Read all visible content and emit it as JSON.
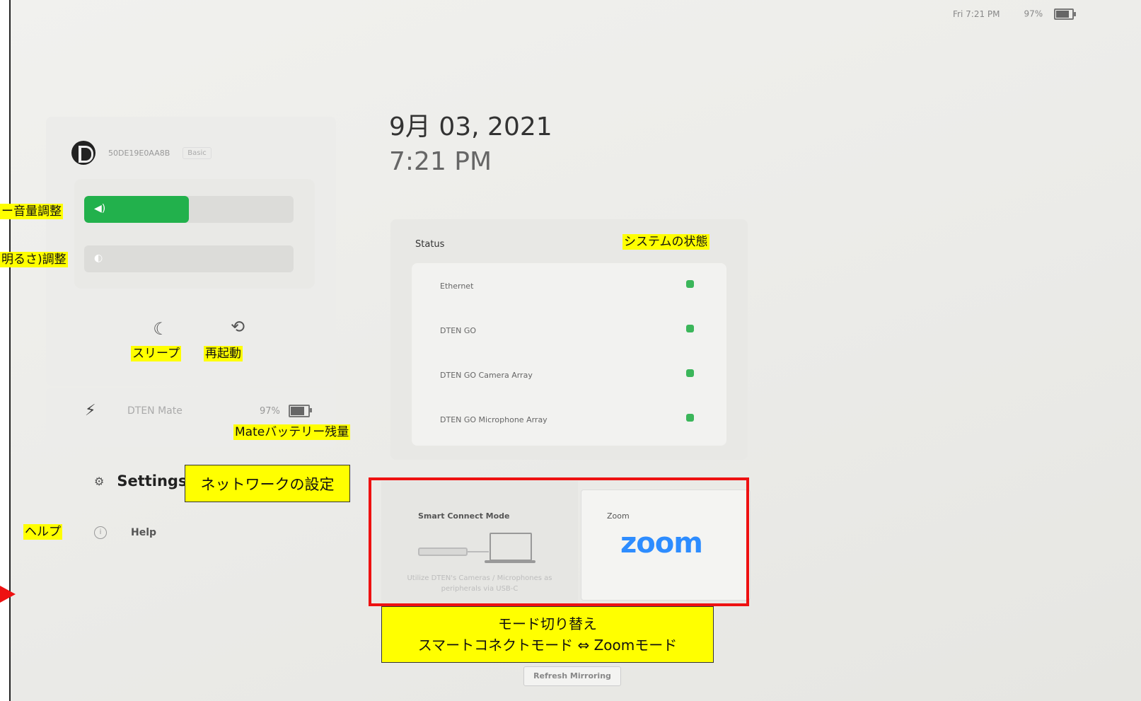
{
  "topbar": {
    "time": "Fri 7:21 PM",
    "battery": "97%"
  },
  "device": {
    "id": "50DE19E0AA8B",
    "tag": "Basic"
  },
  "datetime": {
    "date": "9月 03, 2021",
    "time": "7:21 PM"
  },
  "controls": {
    "volume_level": 0.5,
    "brightness_level": 0.0
  },
  "mate": {
    "name": "DTEN Mate",
    "battery": "97%"
  },
  "menu": {
    "settings": "Settings",
    "help": "Help"
  },
  "status": {
    "title": "Status",
    "items": [
      {
        "label": "Ethernet"
      },
      {
        "label": "DTEN GO"
      },
      {
        "label": "DTEN GO Camera Array"
      },
      {
        "label": "DTEN GO Microphone Array"
      }
    ]
  },
  "modes": {
    "smart_title": "Smart Connect Mode",
    "smart_desc": "Utilize DTEN's Cameras / Microphones as peripherals via USB-C",
    "zoom_title": "Zoom",
    "zoom_logo": "zoom"
  },
  "refresh_button": "Refresh Mirroring",
  "annotations": {
    "volume": "ー音量調整",
    "brightness": "明るさ)調整",
    "sleep": "スリープ",
    "restart": "再起動",
    "system_status": "システムの状態",
    "mate_battery": "Mateバッテリー残量",
    "network_settings": "ネットワークの設定",
    "help": "ヘルプ",
    "mode_switch_line1": "モード切り替え",
    "mode_switch_line2": "スマートコネクトモード ⇔ Zoomモード"
  }
}
